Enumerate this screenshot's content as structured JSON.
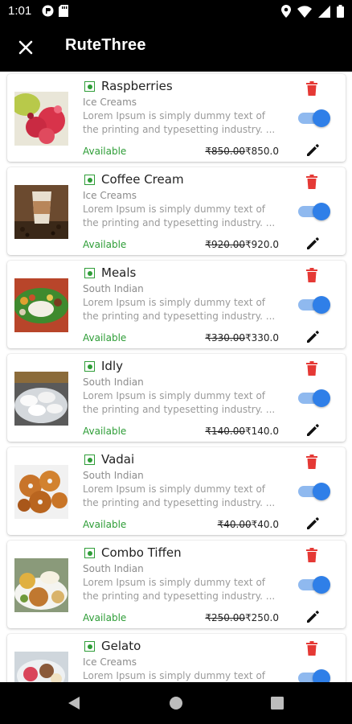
{
  "status_bar": {
    "time": "1:01"
  },
  "app_bar": {
    "title": "RuteThree"
  },
  "items": [
    {
      "name": "Raspberries",
      "category": "Ice Creams",
      "desc_line1": "Lorem Ipsum is simply dummy text of",
      "desc_line2": "the printing and typesetting industry. ...",
      "status": "Available",
      "old_price": "₹850.00",
      "price": "₹850.0"
    },
    {
      "name": "Coffee Cream",
      "category": "Ice Creams",
      "desc_line1": "Lorem Ipsum is simply dummy text of",
      "desc_line2": "the printing and typesetting industry. ...",
      "status": "Available",
      "old_price": "₹920.00",
      "price": "₹920.0"
    },
    {
      "name": "Meals",
      "category": "South Indian",
      "desc_line1": "Lorem Ipsum is simply dummy text of",
      "desc_line2": "the printing and typesetting industry. ...",
      "status": "Available",
      "old_price": "₹330.00",
      "price": "₹330.0"
    },
    {
      "name": "Idly",
      "category": "South Indian",
      "desc_line1": "Lorem Ipsum is simply dummy text of",
      "desc_line2": "the printing and typesetting industry. ...",
      "status": "Available",
      "old_price": "₹140.00",
      "price": "₹140.0"
    },
    {
      "name": "Vadai",
      "category": "South Indian",
      "desc_line1": "Lorem Ipsum is simply dummy text of",
      "desc_line2": "the printing and typesetting industry. ...",
      "status": "Available",
      "old_price": "₹40.00",
      "price": "₹40.0"
    },
    {
      "name": "Combo Tiffen",
      "category": "South Indian",
      "desc_line1": "Lorem Ipsum is simply dummy text of",
      "desc_line2": "the printing and typesetting industry. ...",
      "status": "Available",
      "old_price": "₹250.00",
      "price": "₹250.0"
    },
    {
      "name": "Gelato",
      "category": "Ice Creams",
      "desc_line1": "Lorem Ipsum is simply dummy text of",
      "desc_line2": "",
      "status": "",
      "old_price": "",
      "price": ""
    }
  ],
  "colors": {
    "available": "#2e9d37",
    "toggle_on": "#2f7fe8",
    "delete": "#e53935",
    "bar": "#000000"
  },
  "icons": {
    "close": "close-icon",
    "delete": "trash-icon",
    "edit": "pencil-icon",
    "veg": "veg-indicator-icon"
  }
}
